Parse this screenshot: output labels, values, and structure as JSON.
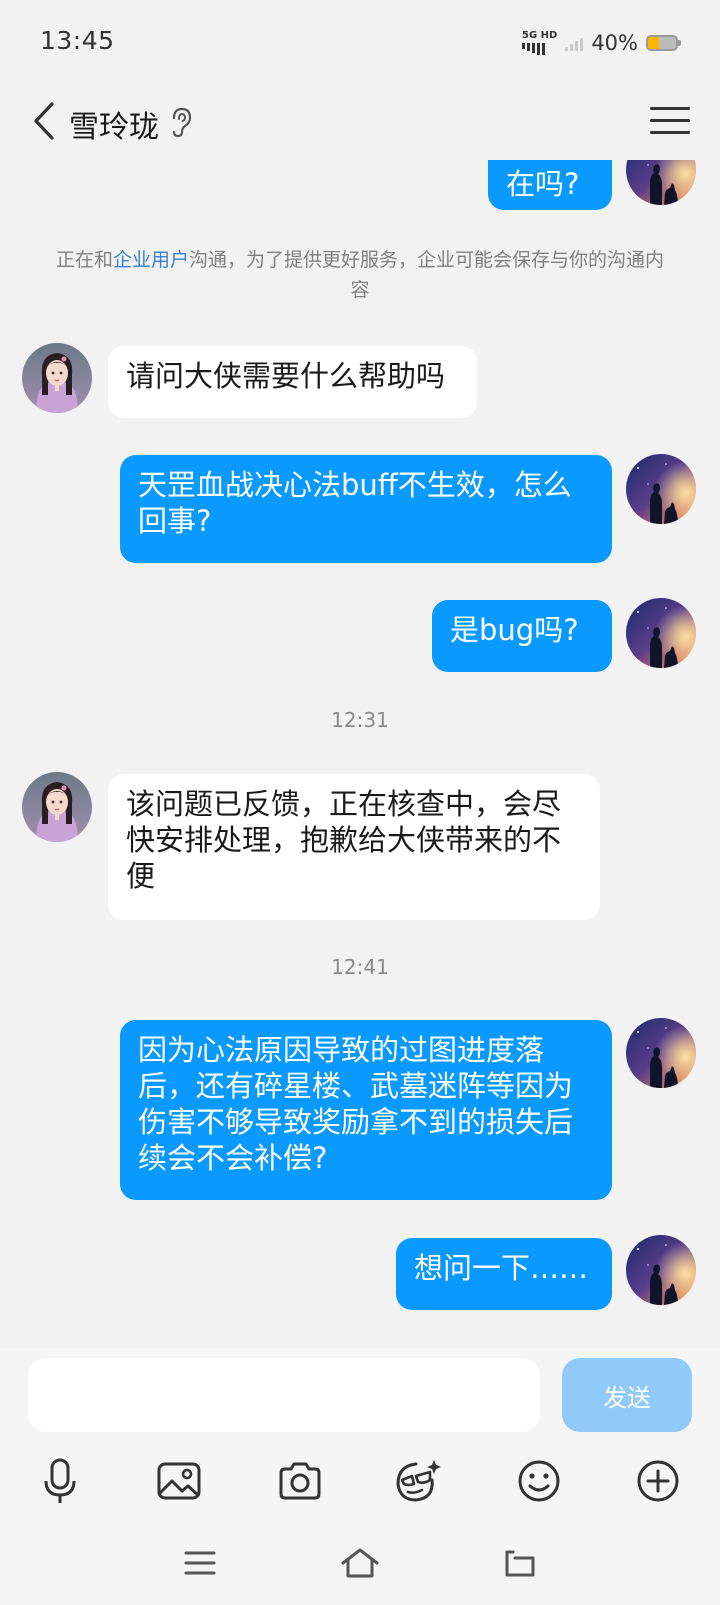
{
  "status": {
    "time": "13:45",
    "network": "5G HD",
    "battery": "40%",
    "battery_level": 0.4
  },
  "header": {
    "title": "雪玲珑"
  },
  "chat": {
    "partial_message": "在吗?",
    "notice_pre": "正在和",
    "notice_link": "企业用户",
    "notice_post": "沟通，为了提供更好服务，企业可能会保存与你的沟通内容",
    "messages": [
      {
        "side": "in",
        "text": "请问大侠需要什么帮助吗"
      },
      {
        "side": "out",
        "text": "天罡血战决心法buff不生效，怎么回事?"
      },
      {
        "side": "out",
        "text": "是bug吗?"
      },
      {
        "side": "time",
        "text": "12:31"
      },
      {
        "side": "in",
        "text": "该问题已反馈，正在核查中，会尽快安排处理，抱歉给大侠带来的不便"
      },
      {
        "side": "time",
        "text": "12:41"
      },
      {
        "side": "out",
        "text": "因为心法原因导致的过图进度落后，还有碎星楼、武墓迷阵等因为伤害不够导致奖励拿不到的损失后续会不会补偿?"
      },
      {
        "side": "out",
        "text": "想问一下……"
      }
    ]
  },
  "input": {
    "value": "",
    "placeholder": "",
    "send_label": "发送"
  },
  "toolbar": [
    "microphone-icon",
    "image-icon",
    "camera-icon",
    "sticker-icon",
    "emoji-icon",
    "plus-icon"
  ],
  "colors": {
    "outgoing_bubble": "#0a99ff",
    "incoming_bubble": "#ffffff",
    "background": "#f2f2f2",
    "send_button": "#8fcaf8",
    "link": "#3a7fd5"
  }
}
